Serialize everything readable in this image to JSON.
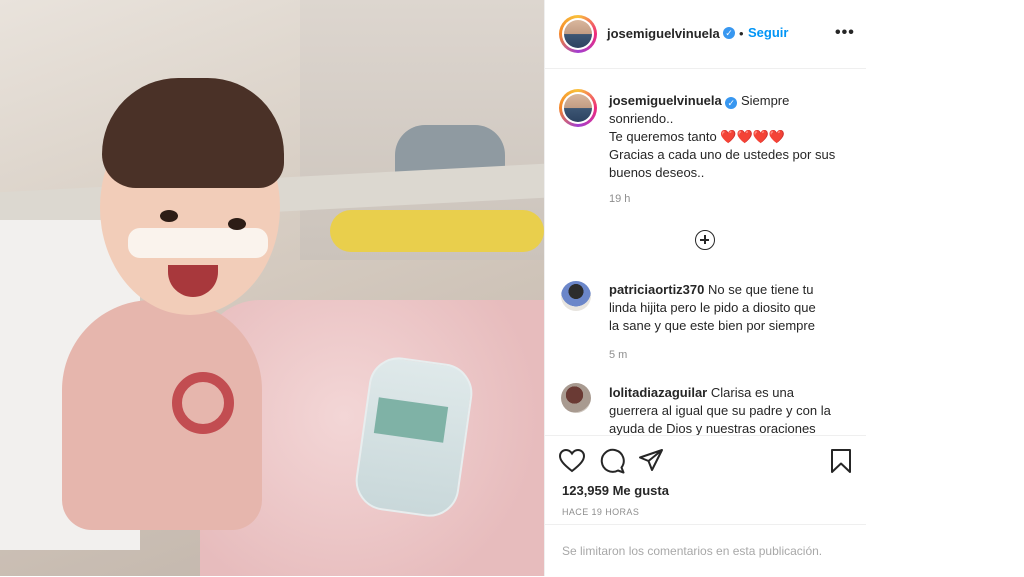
{
  "post": {
    "username": "josemiguelvinuela",
    "follow_label": "Seguir",
    "follow_separator": "•",
    "more_label": "•••"
  },
  "caption": {
    "username": "josemiguelvinuela",
    "lines": [
      "Siempre",
      "sonriendo..",
      "Te queremos tanto",
      "Gracias a cada uno de ustedes por sus",
      "buenos deseos.."
    ],
    "hearts": "❤️❤️❤️❤️",
    "time": "19 h"
  },
  "comments": [
    {
      "username": "patriciaortiz370",
      "text_lines": [
        "No se que tiene tu",
        "linda hijita pero le pido a diosito que",
        "la sane y que este bien por siempre"
      ],
      "time": "5 m"
    },
    {
      "username": "lolitadiazaguilar",
      "text_lines": [
        "Clarisa es una",
        "guerrera al igual que su padre y con la",
        "ayuda de Dios y nuestras oraciones"
      ],
      "time": ""
    }
  ],
  "footer": {
    "likes": "123,959 Me gusta",
    "when": "HACE 19 HORAS",
    "comments_limited": "Se limitaron los comentarios en esta publicación."
  },
  "icons": {
    "like": "heart-icon",
    "comment": "comment-icon",
    "share": "send-icon",
    "save": "bookmark-icon",
    "verified": "verified-badge-icon",
    "load_more": "plus-circle-icon"
  },
  "colors": {
    "link_blue": "#0095f6",
    "verified_blue": "#3897f0",
    "text": "#262626",
    "muted": "#8e8e8e"
  }
}
